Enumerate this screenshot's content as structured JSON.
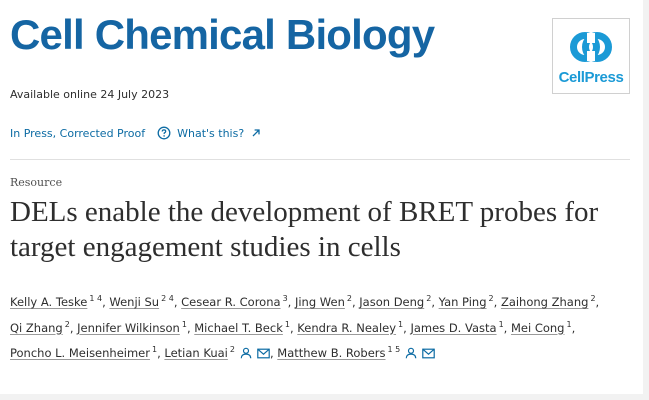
{
  "journal": {
    "title": "Cell Chemical Biology"
  },
  "publisher": {
    "logo_text": "CellPress"
  },
  "article": {
    "available": "Available online 24 July 2023",
    "status": "In Press, Corrected Proof",
    "whats_this": "What's this?",
    "type": "Resource",
    "title": "DELs enable the development of BRET probes for target engagement studies in cells"
  },
  "authors": [
    {
      "name": "Kelly A. Teske",
      "aff": "1 4"
    },
    {
      "name": "Wenji Su",
      "aff": "2 4"
    },
    {
      "name": "Cesear R. Corona",
      "aff": "3"
    },
    {
      "name": "Jing Wen",
      "aff": "2"
    },
    {
      "name": "Jason Deng",
      "aff": "2"
    },
    {
      "name": "Yan Ping",
      "aff": "2"
    },
    {
      "name": "Zaihong Zhang",
      "aff": "2"
    },
    {
      "name": "Qi Zhang",
      "aff": "2"
    },
    {
      "name": "Jennifer Wilkinson",
      "aff": "1"
    },
    {
      "name": "Michael T. Beck",
      "aff": "1"
    },
    {
      "name": "Kendra R. Nealey",
      "aff": "1"
    },
    {
      "name": "James D. Vasta",
      "aff": "1"
    },
    {
      "name": "Mei Cong",
      "aff": "1"
    },
    {
      "name": "Poncho L. Meisenheimer",
      "aff": "1"
    },
    {
      "name": "Letian Kuai",
      "aff": "2"
    },
    {
      "name": "Matthew B. Robers",
      "aff": "1 5"
    }
  ],
  "icons": {
    "help": "question-circle-icon",
    "external": "arrow-up-right-icon",
    "person": "person-icon",
    "email": "envelope-icon"
  },
  "colors": {
    "journal_blue": "#1565a3",
    "link_blue": "#0c6ba3",
    "cellpress_blue": "#1b9ad6"
  }
}
